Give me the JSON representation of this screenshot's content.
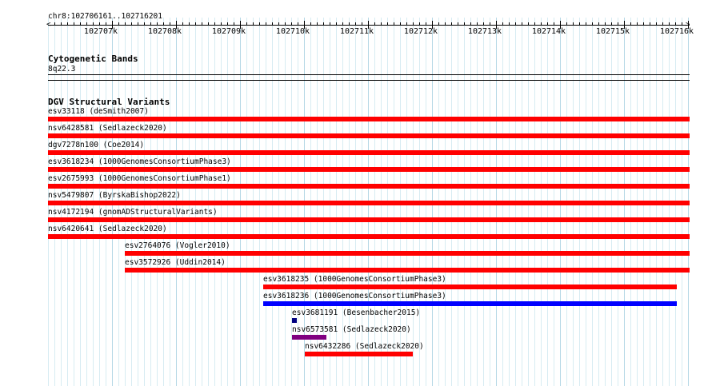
{
  "header": {
    "locus": "chr8:102706161..102716201"
  },
  "ruler": {
    "ticks": [
      "102707k",
      "102708k",
      "102709k",
      "102710k",
      "102711k",
      "102712k",
      "102713k",
      "102714k",
      "102715k",
      "102716k"
    ]
  },
  "cytoband": {
    "title": "Cytogenetic Bands",
    "band": "8q22.3"
  },
  "dgv": {
    "title": "DGV Structural Variants",
    "variants": [
      {
        "label": "esv33118 (deSmith2007)",
        "color": "#ff0000"
      },
      {
        "label": "nsv6428581 (Sedlazeck2020)",
        "color": "#ff0000"
      },
      {
        "label": "dgv7278n100 (Coe2014)",
        "color": "#ff0000"
      },
      {
        "label": "esv3618234 (1000GenomesConsortiumPhase3)",
        "color": "#ff0000"
      },
      {
        "label": "esv2675993 (1000GenomesConsortiumPhase1)",
        "color": "#ff0000"
      },
      {
        "label": "nsv5479807 (ByrskaBishop2022)",
        "color": "#ff0000"
      },
      {
        "label": "nsv4172194 (gnomADStructuralVariants)",
        "color": "#ff0000"
      },
      {
        "label": "nsv6420641 (Sedlazeck2020)",
        "color": "#ff0000"
      },
      {
        "label": "esv2764076 (Vogler2010)",
        "color": "#ff0000"
      },
      {
        "label": "esv3572926 (Uddin2014)",
        "color": "#ff0000"
      },
      {
        "label": "esv3618235 (1000GenomesConsortiumPhase3)",
        "color": "#ff0000"
      },
      {
        "label": "esv3618236 (1000GenomesConsortiumPhase3)",
        "color": "#0000ff"
      },
      {
        "label": "esv3681191 (Besenbacher2015)",
        "color": "#000080"
      },
      {
        "label": "nsv6573581 (Sedlazeck2020)",
        "color": "#800080"
      },
      {
        "label": "nsv6432286 (Sedlazeck2020)",
        "color": "#ff0000"
      }
    ]
  }
}
